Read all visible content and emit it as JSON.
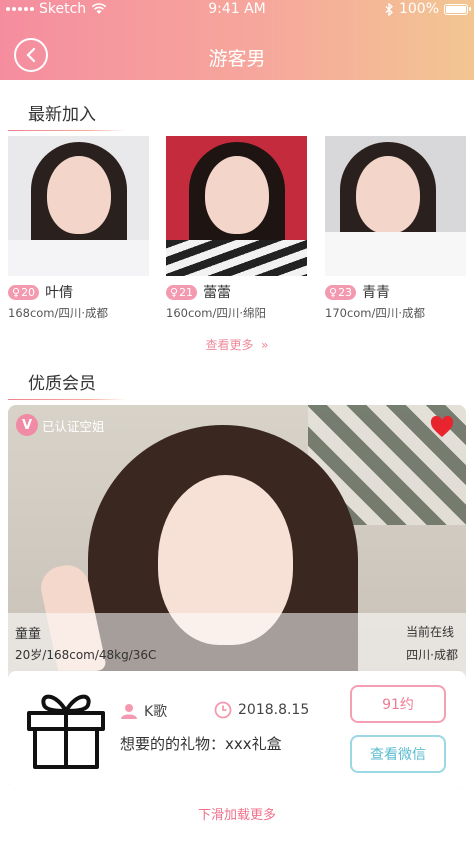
{
  "status_bar": {
    "carrier": "Sketch",
    "time": "9:41 AM",
    "battery": "100%"
  },
  "header": {
    "title": "游客男"
  },
  "sections": {
    "new_members_title": "最新加入",
    "premium_title": "优质会员"
  },
  "new_members": [
    {
      "age": "20",
      "name": "叶倩",
      "details": "168com/四川·成都"
    },
    {
      "age": "21",
      "name": "蕾蕾",
      "details": "160com/四川·绵阳"
    },
    {
      "age": "23",
      "name": "青青",
      "details": "170com/四川·成都"
    }
  ],
  "view_more": "查看更多",
  "premium_member": {
    "verified_label": "已认证空姐",
    "verified_badge": "V",
    "name": "童童",
    "stats": "20岁/168com/48kg/36C",
    "online_status": "当前在线",
    "location": "四川·成都",
    "hobby": "K歌",
    "date": "2018.8.15",
    "gift_wish": "想要的的礼物：xxx礼盒",
    "date_button": "91约",
    "wechat_button": "查看微信"
  },
  "load_more": "下滑加载更多",
  "colors": {
    "accent": "#f08aa5",
    "header_start": "#f58d9f",
    "header_end": "#f2c692"
  }
}
